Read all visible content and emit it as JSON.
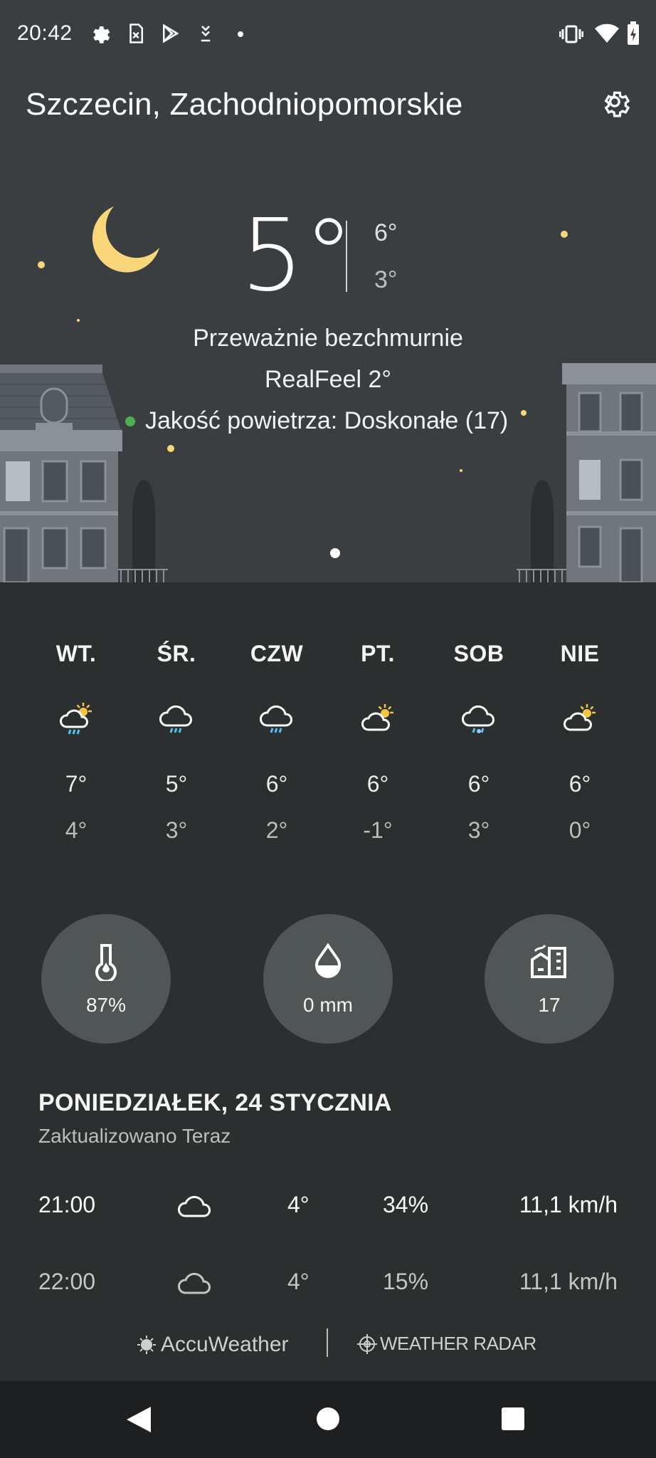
{
  "status_bar": {
    "time": "20:42"
  },
  "header": {
    "location": "Szczecin, Zachodniopomorskie"
  },
  "current": {
    "temperature": "5°",
    "high": "6°",
    "low": "3°",
    "condition": "Przeważnie bezchmurnie",
    "realfeel": "RealFeel 2°",
    "air_quality": "Jakość powietrza: Doskonałe (17)"
  },
  "forecast": [
    {
      "day": "WT.",
      "high": "7°",
      "low": "4°",
      "icon": "partly-sunny-rain-icon"
    },
    {
      "day": "ŚR.",
      "high": "5°",
      "low": "3°",
      "icon": "rain-icon"
    },
    {
      "day": "CZW",
      "high": "6°",
      "low": "2°",
      "icon": "rain-icon"
    },
    {
      "day": "PT.",
      "high": "6°",
      "low": "-1°",
      "icon": "partly-sunny-icon"
    },
    {
      "day": "SOB",
      "high": "6°",
      "low": "3°",
      "icon": "snow-rain-icon"
    },
    {
      "day": "NIE",
      "high": "6°",
      "low": "0°",
      "icon": "partly-sunny-icon"
    }
  ],
  "metrics": {
    "humidity": "87%",
    "precipitation": "0 mm",
    "air_quality_index": "17"
  },
  "day_section": {
    "date": "PONIEDZIAŁEK, 24 STYCZNIA",
    "updated": "Zaktualizowano Teraz"
  },
  "hourly": [
    {
      "time": "21:00",
      "temp": "4°",
      "precip": "34%",
      "wind": "11,1 km/h"
    },
    {
      "time": "22:00",
      "temp": "4°",
      "precip": "15%",
      "wind": "11,1 km/h"
    }
  ],
  "footer": {
    "brand1": "AccuWeather",
    "brand2": "WEATHER RADAR"
  },
  "colors": {
    "hero_bg": "#3a3e41",
    "content_bg": "#2b2f30",
    "moon": "#f9d67a",
    "air_quality_good": "#4caf50",
    "metric_circle": "#505556"
  }
}
